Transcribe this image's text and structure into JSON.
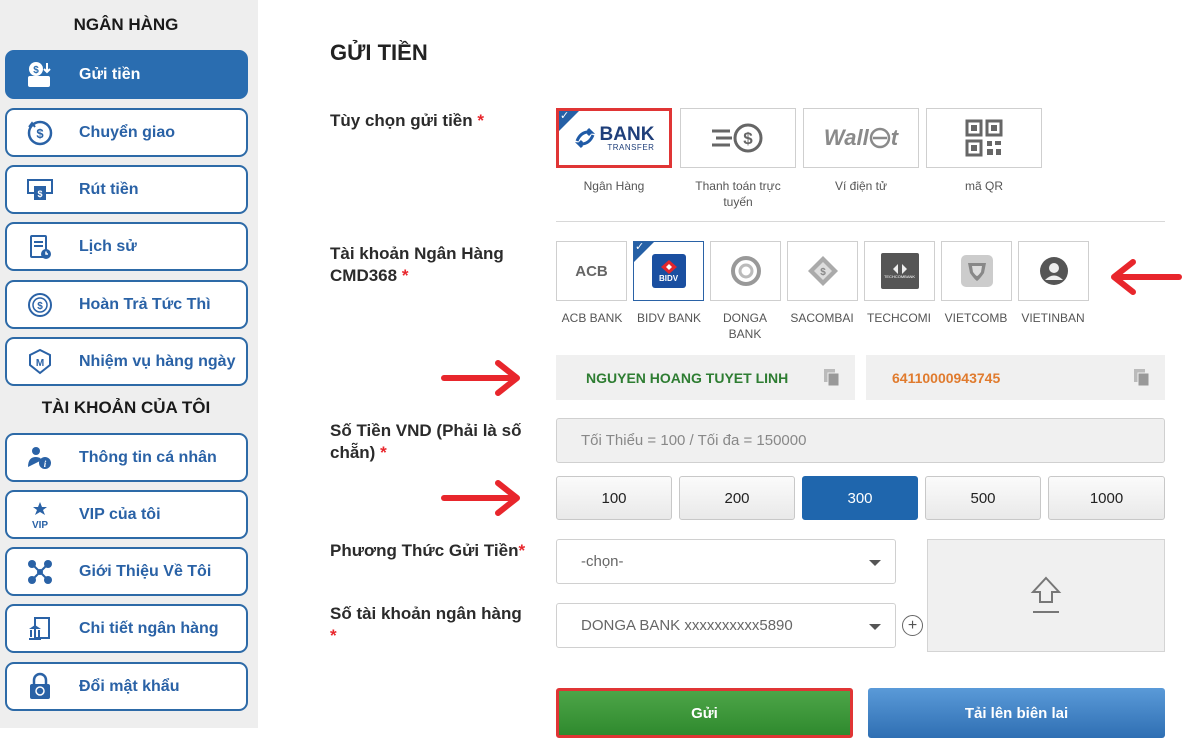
{
  "sidebar": {
    "bank_title": "NGÂN HÀNG",
    "bank_items": [
      {
        "label": "Gửi tiền",
        "icon": "deposit-icon"
      },
      {
        "label": "Chuyển giao",
        "icon": "transfer-icon"
      },
      {
        "label": "Rút tiền",
        "icon": "withdraw-icon"
      },
      {
        "label": "Lịch sử",
        "icon": "history-icon"
      },
      {
        "label": "Hoàn Trả Tức Thì",
        "icon": "refund-icon"
      },
      {
        "label": "Nhiệm vụ hàng ngày",
        "icon": "mission-icon"
      }
    ],
    "account_title": "TÀI KHOẢN CỦA TÔI",
    "account_items": [
      {
        "label": "Thông tin cá nhân",
        "icon": "profile-icon"
      },
      {
        "label": "VIP của tôi",
        "icon": "vip-icon"
      },
      {
        "label": "Giới Thiệu Về Tôi",
        "icon": "referral-icon"
      },
      {
        "label": "Chi tiết ngân hàng",
        "icon": "bank-detail-icon"
      },
      {
        "label": "Đổi mật khẩu",
        "icon": "password-icon"
      }
    ]
  },
  "main": {
    "title": "GỬI TIỀN",
    "deposit_option_label": "Tùy chọn gửi tiền",
    "required_mark": "*",
    "deposit_options": [
      {
        "label": "Ngân Hàng",
        "logo": "BANK",
        "logo_sub": "TRANSFER",
        "selected": true
      },
      {
        "label": "Thanh toán trực tuyến",
        "selected": false
      },
      {
        "label": "Ví điện tử",
        "logo": "Wall",
        "logo_tail": "t",
        "selected": false
      },
      {
        "label": "mã QR",
        "selected": false
      }
    ],
    "bank_account_label": "Tài khoản Ngân Hàng CMD368",
    "banks": [
      {
        "label": "ACB BANK",
        "logo": "ACB"
      },
      {
        "label": "BIDV BANK",
        "logo": "BIDV",
        "selected": true
      },
      {
        "label": "DONGA BANK"
      },
      {
        "label": "SACOMBAI"
      },
      {
        "label": "TECHCOMI",
        "logo": "TECHCOMBANK"
      },
      {
        "label": "VIETCOMB"
      },
      {
        "label": "VIETINBAN"
      }
    ],
    "account_name": "NGUYEN HOANG TUYET LINH",
    "account_number": "64110000943745",
    "amount_label": "Số Tiền VND (Phải là số chẵn)",
    "amount_placeholder": "Tối Thiểu = 100 / Tối đa = 150000",
    "amounts": [
      "100",
      "200",
      "300",
      "500",
      "1000"
    ],
    "selected_amount": "300",
    "method_label": "Phương Thức Gửi Tiền",
    "method_value": "-chọn-",
    "source_account_label": "Số tài khoản ngân hàng",
    "source_account_value": "DONGA BANK xxxxxxxxxx5890",
    "send_button": "Gửi",
    "upload_button": "Tải lên biên lai"
  },
  "colors": {
    "primary": "#2a6db0",
    "highlight": "#e03535",
    "send_green": "#3a9a38",
    "account_name": "#2e7d32",
    "account_number": "#e07b2e"
  }
}
